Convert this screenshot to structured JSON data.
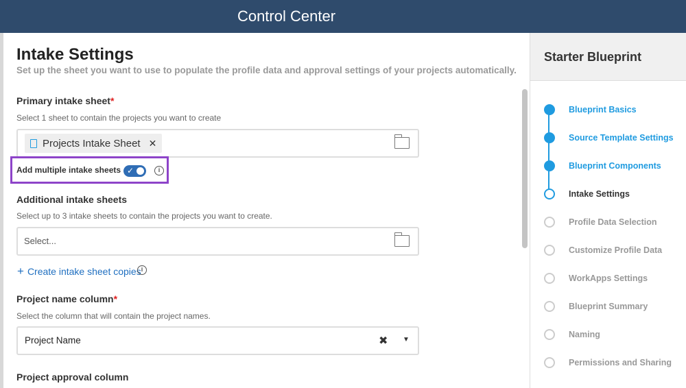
{
  "header": {
    "title": "Control Center"
  },
  "main": {
    "title": "Intake Settings",
    "subtitle": "Set up the sheet you want to use to populate the profile data and approval settings of your projects automatically.",
    "primary": {
      "label": "Primary intake sheet",
      "required": "*",
      "hint": "Select 1 sheet to contain the projects you want to create",
      "chip": "Projects Intake Sheet",
      "remove": "✕"
    },
    "multiple": {
      "label": "Add multiple intake sheets",
      "enabled": true,
      "check": "✓",
      "info": "i"
    },
    "additional": {
      "label": "Additional intake sheets",
      "hint": "Select up to 3 intake sheets to contain the projects you want to create.",
      "placeholder": "Select..."
    },
    "copies": {
      "plus": "+",
      "label": "Create intake sheet copies",
      "info": "i"
    },
    "name_col": {
      "label": "Project name column",
      "required": "*",
      "hint": "Select the column that will contain the project names.",
      "value": "Project Name",
      "clear": "✖",
      "caret": "▼"
    },
    "approval": {
      "label": "Project approval column"
    }
  },
  "sidebar": {
    "title": "Starter Blueprint",
    "steps": [
      {
        "label": "Blueprint Basics",
        "state": "done"
      },
      {
        "label": "Source Template Settings",
        "state": "done"
      },
      {
        "label": "Blueprint Components",
        "state": "done"
      },
      {
        "label": "Intake Settings",
        "state": "current"
      },
      {
        "label": "Profile Data Selection",
        "state": "todo"
      },
      {
        "label": "Customize Profile Data",
        "state": "todo"
      },
      {
        "label": "WorkApps Settings",
        "state": "todo"
      },
      {
        "label": "Blueprint Summary",
        "state": "todo"
      },
      {
        "label": "Naming",
        "state": "todo"
      },
      {
        "label": "Permissions and Sharing",
        "state": "todo"
      }
    ]
  },
  "colors": {
    "header": "#2f4b6c",
    "accent": "#1f9be0",
    "link": "#1f6fc0",
    "highlight": "#8e44c9"
  }
}
